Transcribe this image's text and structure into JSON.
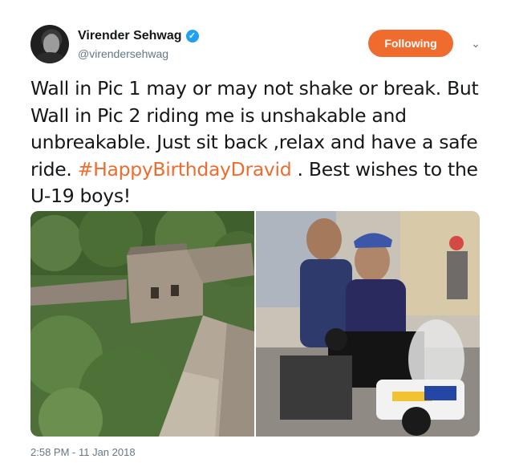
{
  "author": {
    "display_name": "Virender Sehwag",
    "handle": "@virendersehwag",
    "verified_badge": "verified-badge",
    "avatar": "avatar-photo"
  },
  "actions": {
    "follow_label": "Following",
    "menu_icon": "chevron-down-icon"
  },
  "tweet": {
    "text_before": "Wall in Pic 1 may or may not shake or break. But Wall in Pic 2 riding me is unshakable and unbreakable. Just sit back ,relax and have a safe ride. ",
    "hashtag": "#HappyBirthdayDravid",
    "text_after": " . Best wishes to the U-19 boys!"
  },
  "media": {
    "photos": [
      "great-wall-photo",
      "motorbike-photo"
    ]
  },
  "timestamp": "2:58 PM - 11 Jan 2018",
  "colors": {
    "accent": "#f06b2e",
    "verified": "#1da1f2",
    "secondary_text": "#657786"
  }
}
